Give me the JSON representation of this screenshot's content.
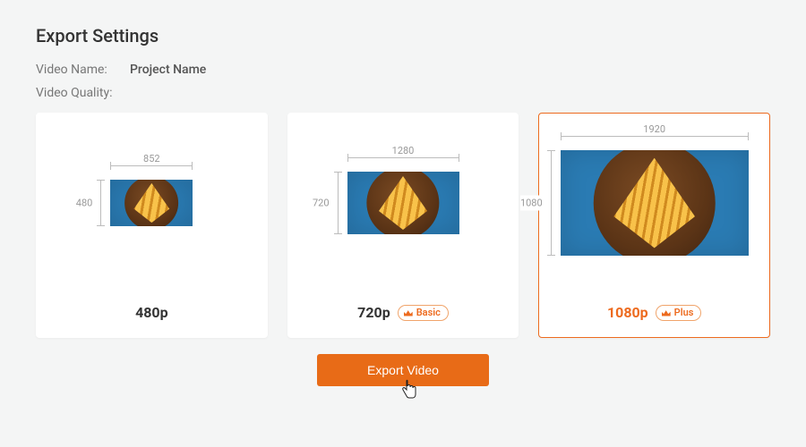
{
  "page": {
    "title": "Export Settings",
    "videoNameLabel": "Video Name:",
    "videoName": "Project Name",
    "videoQualityLabel": "Video Quality:"
  },
  "options": [
    {
      "id": "480p",
      "width": "852",
      "height": "480",
      "label": "480p",
      "badge": null,
      "selected": false
    },
    {
      "id": "720p",
      "width": "1280",
      "height": "720",
      "label": "720p",
      "badge": "Basic",
      "selected": false
    },
    {
      "id": "1080p",
      "width": "1920",
      "height": "1080",
      "label": "1080p",
      "badge": "Plus",
      "selected": true
    }
  ],
  "exportButton": "Export Video"
}
